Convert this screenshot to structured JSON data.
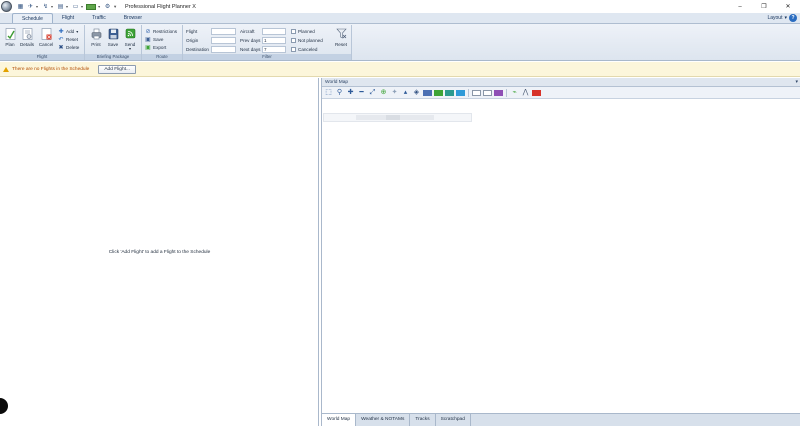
{
  "app": {
    "title": "Professional Flight Planner X",
    "window_controls": {
      "minimize": "–",
      "restore": "❐",
      "close": "✕"
    }
  },
  "ribbon_tabs": {
    "schedule": "Schedule",
    "flight": "Flight",
    "traffic": "Traffic",
    "browser": "Browser",
    "layout": "Layout",
    "help": "?"
  },
  "ribbon": {
    "flight_group": {
      "label": "Flight",
      "plan": "Plan",
      "details": "Details",
      "cancel": "Cancel",
      "add": "Add",
      "reset": "Reset",
      "delete": "Delete"
    },
    "briefing_group": {
      "label": "Briefing Package",
      "print": "Print",
      "save": "Save",
      "send": "Send"
    },
    "route_group": {
      "label": "Route",
      "restrictions": "Restrictions",
      "save": "Save",
      "export": "Export"
    },
    "filter_group": {
      "label": "Filter",
      "flight_label": "Flight",
      "flight_value": "",
      "origin_label": "Origin",
      "origin_value": "",
      "destination_label": "Destination",
      "destination_value": "",
      "aircraft_label": "Aircraft",
      "aircraft_value": "",
      "prev_days_label": "Prev days",
      "prev_days_value": "1",
      "next_days_label": "Next days",
      "next_days_value": "7",
      "planned": "Planned",
      "not_planned": "Not planned",
      "canceled": "Canceled",
      "reset": "Reset"
    }
  },
  "infobar": {
    "message": "There are no Flights in the Schedule",
    "add_flight": "Add Flight..."
  },
  "schedule": {
    "empty_message": "Click 'Add Flight' to add a Flight to the Schedule"
  },
  "map": {
    "title": "World Map",
    "pin": "📌",
    "tabs": [
      "World Map",
      "Weather & NOTAMs",
      "Tracks",
      "Scratchpad"
    ],
    "colors": {
      "ribbon_bg": "#dde5ef",
      "info_bg": "#fcf6db",
      "warning_text": "#b24b00"
    }
  }
}
